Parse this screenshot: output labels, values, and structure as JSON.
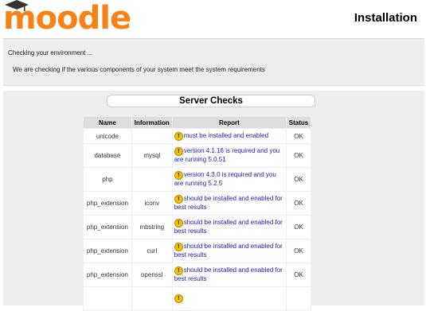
{
  "header": {
    "logo_text": "moodle",
    "title": "Installation"
  },
  "environment": {
    "heading": "Checking your environment ...",
    "description": "We are checking if the various components of your system meet the system requirements"
  },
  "server_checks": {
    "title": "Server Checks",
    "columns": [
      "Name",
      "Information",
      "Report",
      "Status"
    ],
    "rows": [
      {
        "name": "unicode",
        "information": "",
        "report": "must be installed and enabled",
        "status": "OK"
      },
      {
        "name": "database",
        "information": "mysql",
        "report": "version 4.1.16 is required and you are running 5.0.51",
        "status": "OK"
      },
      {
        "name": "php",
        "information": "",
        "report": "version 4.3.0 is required and you are running 5.2.5",
        "status": "OK"
      },
      {
        "name": "php_extension",
        "information": "iconv",
        "report": "should be installed and enabled for best results",
        "status": "OK"
      },
      {
        "name": "php_extension",
        "information": "mbstring",
        "report": "should be installed and enabled for best results",
        "status": "OK"
      },
      {
        "name": "php_extension",
        "information": "curl",
        "report": "should be installed and enabled for best results",
        "status": "OK"
      },
      {
        "name": "php_extension",
        "information": "openssl",
        "report": "should be installed and enabled for best results",
        "status": "OK"
      }
    ]
  },
  "colors": {
    "logo_orange": "#f98012",
    "report_link": "#1a1ab4",
    "warning_icon": "#f5c400"
  },
  "icons": {
    "report": "warning-icon",
    "logo_cap": "graduation-cap-icon"
  }
}
